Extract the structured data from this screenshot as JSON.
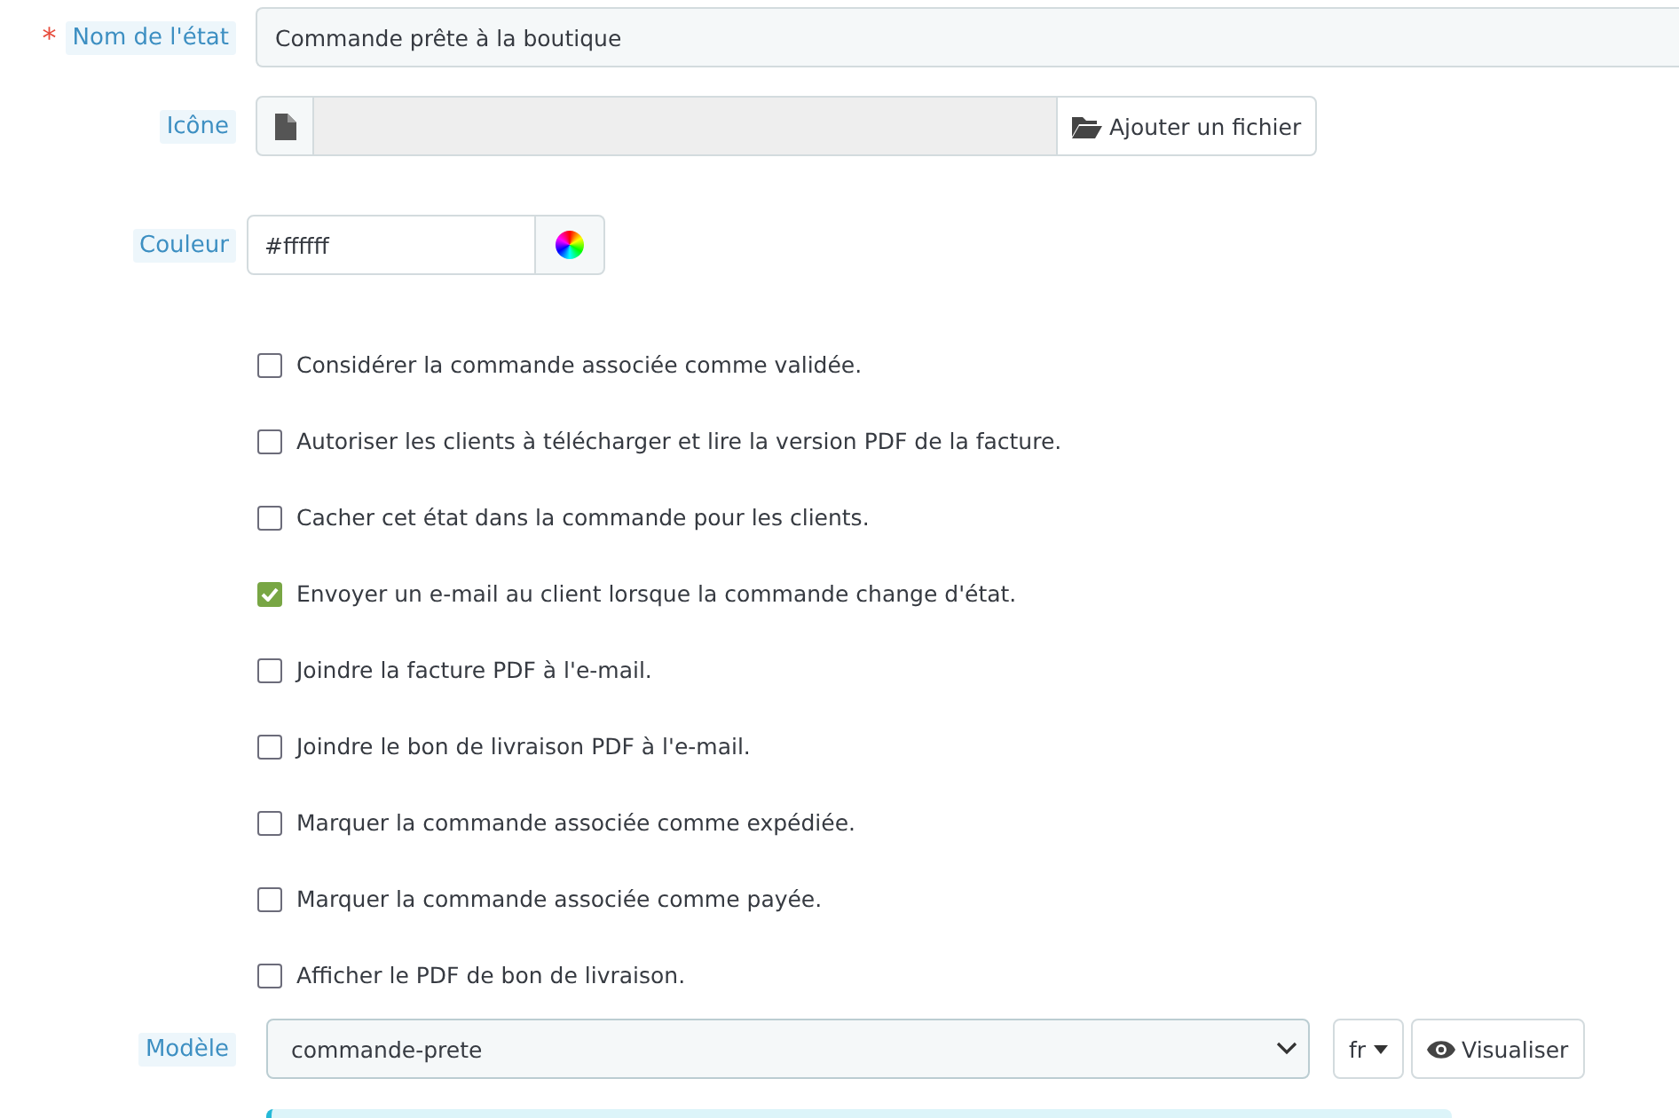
{
  "fields": {
    "name": {
      "label": "Nom de l'état",
      "required_mark": "*",
      "value": "Commande prête à la boutique"
    },
    "icon": {
      "label": "Icône",
      "button": "Ajouter un fichier"
    },
    "color": {
      "label": "Couleur",
      "value": "#ffffff"
    }
  },
  "options": [
    {
      "label": "Considérer la commande associée comme validée.",
      "checked": false
    },
    {
      "label": "Autoriser les clients à télécharger et lire la version PDF de la facture.",
      "checked": false
    },
    {
      "label": "Cacher cet état dans la commande pour les clients.",
      "checked": false
    },
    {
      "label": "Envoyer un e-mail au client lorsque la commande change d'état.",
      "checked": true
    },
    {
      "label": "Joindre la facture PDF à l'e-mail.",
      "checked": false
    },
    {
      "label": "Joindre le bon de livraison PDF à l'e-mail.",
      "checked": false
    },
    {
      "label": "Marquer la commande associée comme expédiée.",
      "checked": false
    },
    {
      "label": "Marquer la commande associée comme payée.",
      "checked": false
    },
    {
      "label": "Afficher le PDF de bon de livraison.",
      "checked": false
    }
  ],
  "template": {
    "label": "Modèle",
    "value": "commande-prete",
    "language": "fr",
    "preview": "Visualiser"
  }
}
